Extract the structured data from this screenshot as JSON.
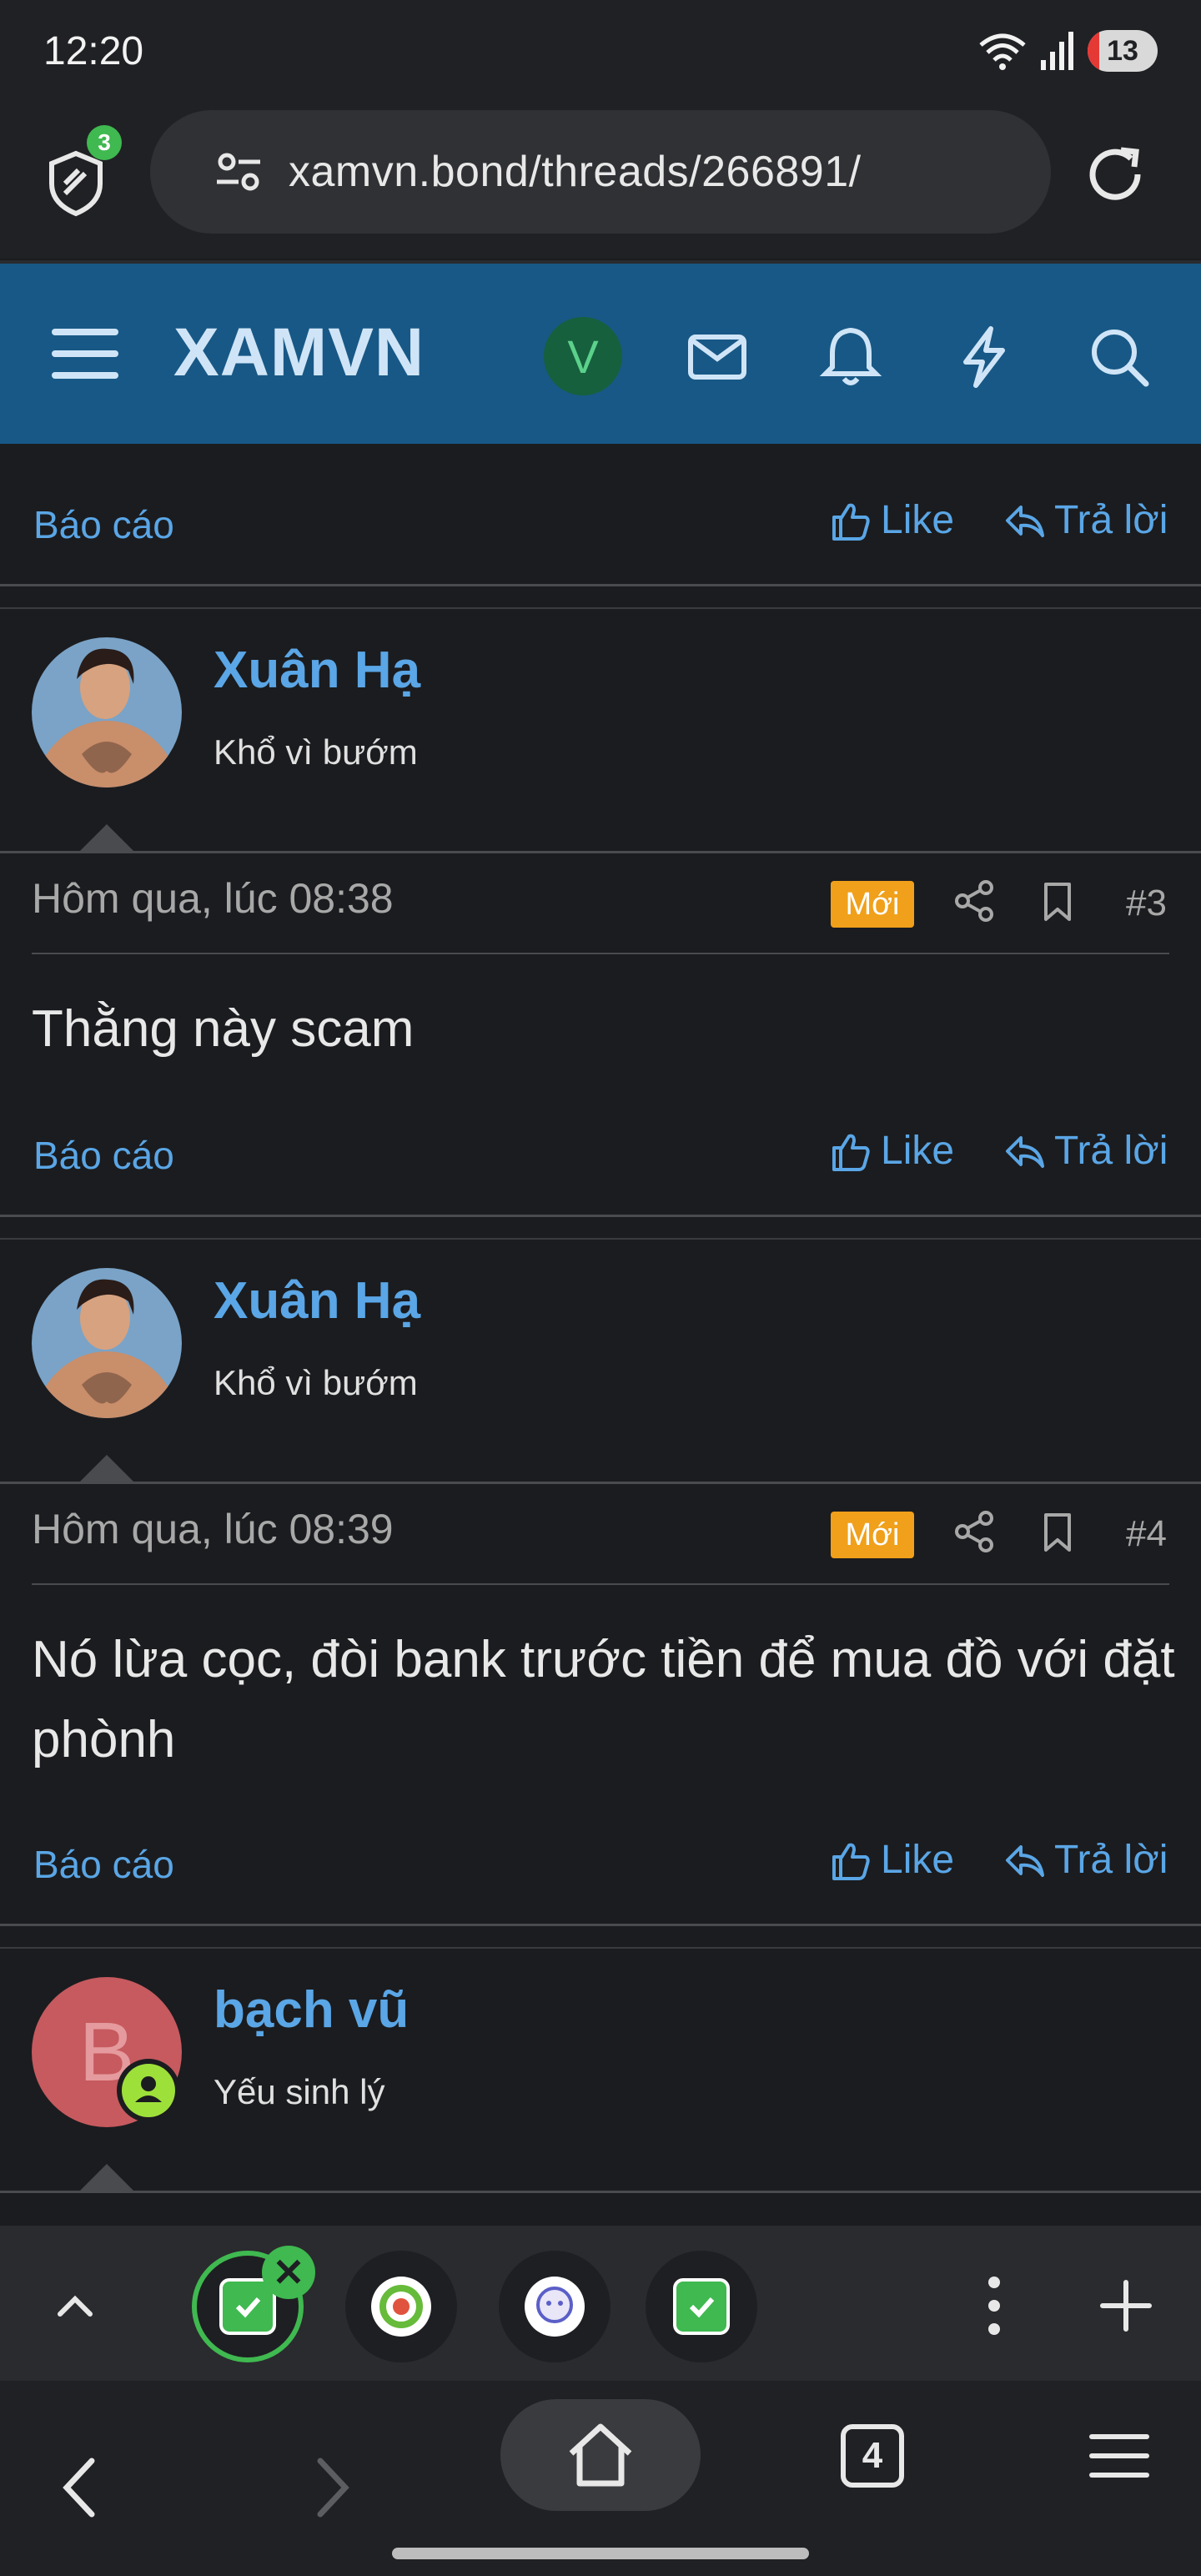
{
  "status_bar": {
    "time": "12:20",
    "battery": "13"
  },
  "browser": {
    "shield_count": "3",
    "url": "xamvn.bond/threads/266891/",
    "tab_count": "4"
  },
  "site": {
    "logo": "XAMVN",
    "user_initial": "V"
  },
  "top_actions": {
    "report": "Báo cáo",
    "like": "Like",
    "reply": "Trả lời"
  },
  "posts": [
    {
      "user": "Xuân Hạ",
      "user_title": "Khổ vì bướm",
      "date": "Hôm qua, lúc 08:38",
      "badge": "Mới",
      "number": "#3",
      "text": "Thằng này scam",
      "report": "Báo cáo",
      "like": "Like",
      "reply": "Trả lời"
    },
    {
      "user": "Xuân Hạ",
      "user_title": "Khổ vì bướm",
      "date": "Hôm qua, lúc 08:39",
      "badge": "Mới",
      "number": "#4",
      "text": "Nó lừa cọc, đòi bank trước tiền để mua đồ với đặt phònh",
      "report": "Báo cáo",
      "like": "Like",
      "reply": "Trả lời"
    },
    {
      "user": "bạch vũ",
      "user_title": "Yếu sinh lý",
      "avatar_letter": "B"
    }
  ],
  "colors": {
    "header_bg": "#185886",
    "link": "#5aa6e6",
    "badge_new": "#f0a01a",
    "accent_green": "#3fb950"
  },
  "icons": {
    "shield": "shield-icon",
    "reload": "reload-icon",
    "menu": "hamburger-icon",
    "mail": "mail-icon",
    "bell": "bell-icon",
    "bolt": "bolt-icon",
    "search": "search-icon"
  }
}
